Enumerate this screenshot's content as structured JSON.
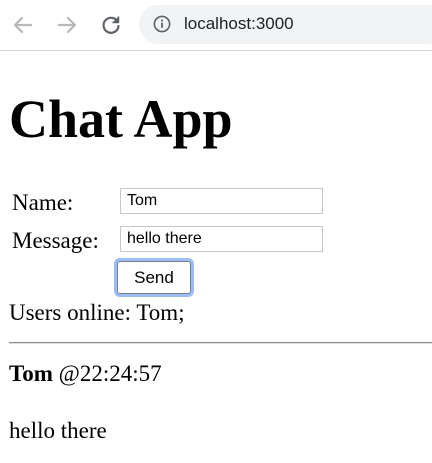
{
  "browser": {
    "url": "localhost:3000",
    "icons": {
      "back": "back-arrow-icon",
      "forward": "forward-arrow-icon",
      "reload": "reload-icon",
      "site_info": "info-icon"
    }
  },
  "page": {
    "title": "Chat App",
    "form": {
      "name_label": "Name:",
      "name_value": "Tom",
      "message_label": "Message:",
      "message_value": "hello there",
      "send_label": "Send"
    },
    "users_online_label": "Users online:",
    "users_online_value": "Tom;",
    "messages": [
      {
        "user": "Tom",
        "time": "@22:24:57",
        "text": "hello there"
      }
    ]
  }
}
